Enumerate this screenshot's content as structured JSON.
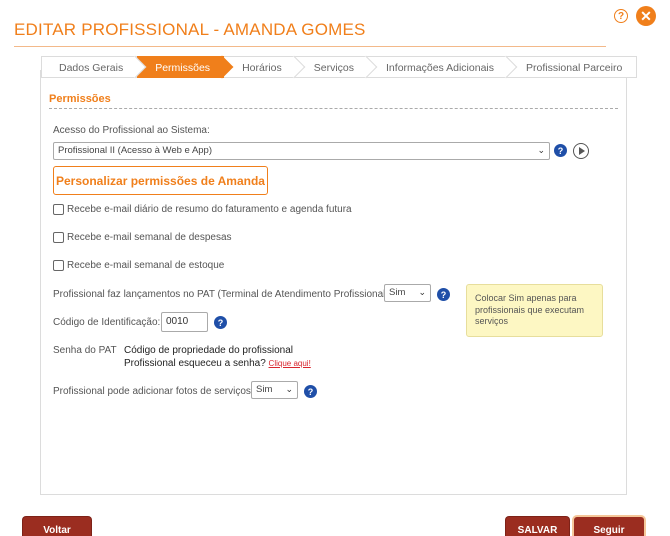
{
  "header": {
    "title": "EDITAR PROFISSIONAL - AMANDA GOMES",
    "help_icon": "question-circle-icon",
    "close_icon": "close-icon",
    "help_glyph": "?",
    "close_glyph": "✕"
  },
  "tabs": [
    {
      "label": "Dados Gerais",
      "active": false
    },
    {
      "label": "Permissões",
      "active": true
    },
    {
      "label": "Horários",
      "active": false
    },
    {
      "label": "Serviços",
      "active": false
    },
    {
      "label": "Informações Adicionais",
      "active": false
    },
    {
      "label": "Profissional Parceiro",
      "active": false
    }
  ],
  "section": {
    "title": "Permissões"
  },
  "access": {
    "label": "Acesso do Profissional ao Sistema:",
    "selected": "Profissional II (Acesso à Web e App)"
  },
  "customize_button": "Personalizar permissões de Amanda",
  "checkboxes": [
    {
      "label": "Recebe e-mail diário de resumo do faturamento e agenda futura",
      "checked": false
    },
    {
      "label": "Recebe e-mail semanal de despesas",
      "checked": false
    },
    {
      "label": "Recebe e-mail semanal de estoque",
      "checked": false
    }
  ],
  "pat": {
    "label": "Profissional faz lançamentos no PAT (Terminal de Atendimento Profissional):",
    "selected": "Sim",
    "note": "Colocar Sim apenas para profissionais que executam serviços"
  },
  "id_code": {
    "label": "Código de Identificação:",
    "value": "0010"
  },
  "pat_password": {
    "label": "Senha do PAT",
    "line1": "Código de propriedade do profissional",
    "line2": "Profissional esqueceu a senha?",
    "link": "Clique aqui!"
  },
  "photos": {
    "label": "Profissional pode adicionar fotos de serviços:",
    "selected": "Sim"
  },
  "footer": {
    "back": "Voltar",
    "save": "SALVAR",
    "next": "Seguir"
  },
  "colors": {
    "accent": "#f07f1b",
    "button_dark": "#9b2d20",
    "help_blue": "#1f4fa8",
    "note_bg": "#fdf7c3"
  }
}
